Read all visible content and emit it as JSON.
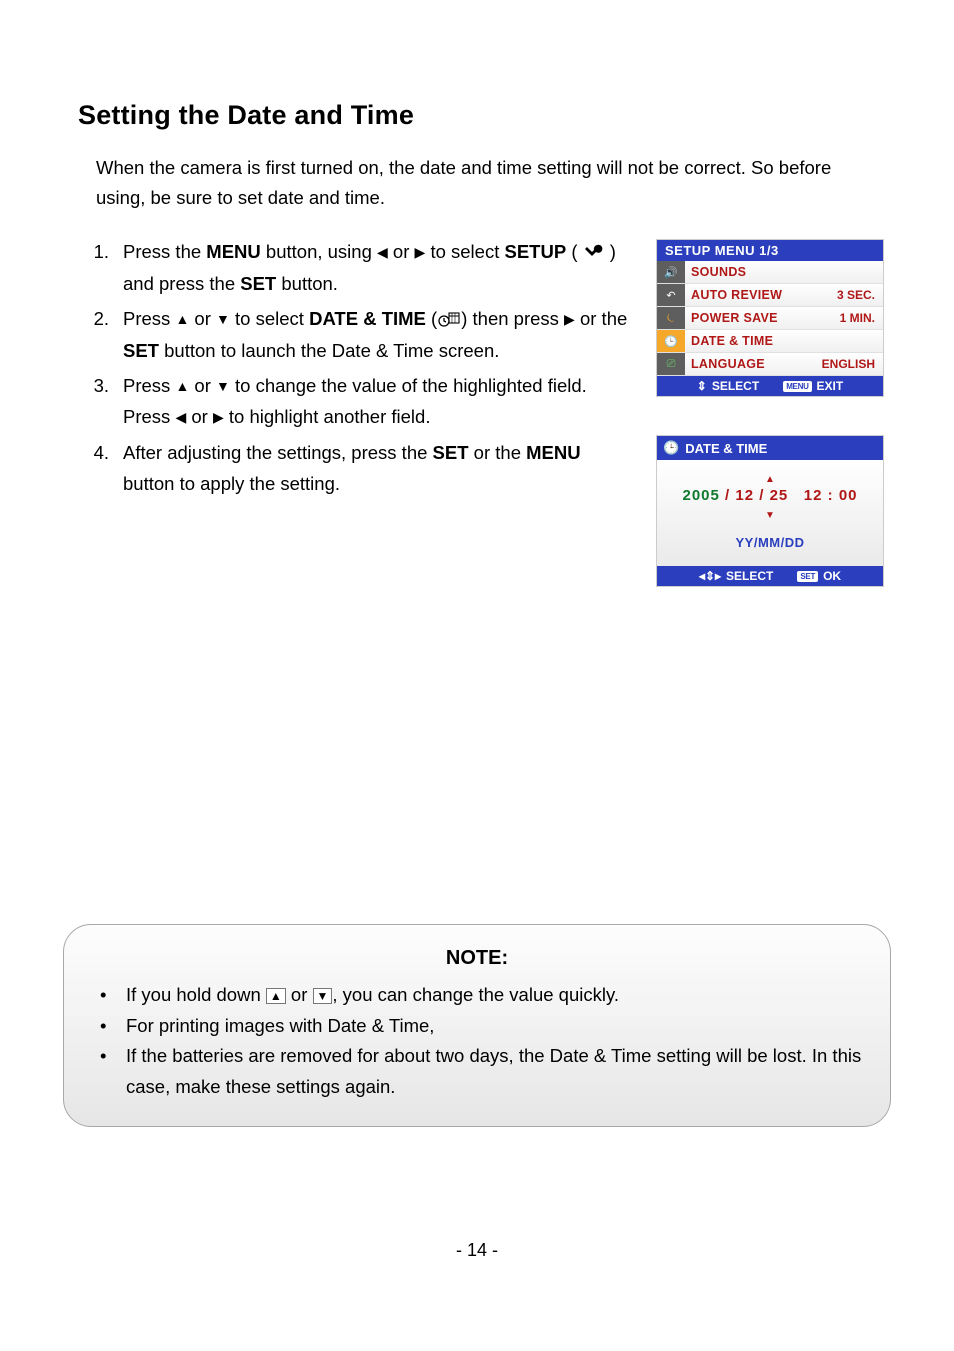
{
  "title": "Setting the Date and Time",
  "intro": "When the camera is first turned on, the date and time setting will not be correct. So before using, be sure to set date and time.",
  "steps": [
    {
      "num": "1.",
      "parts": {
        "a": "Press the ",
        "b": "MENU",
        "c": " button, using ",
        "d": " or ",
        "e": " to select ",
        "f": "SETUP",
        "g": " ( ",
        "h": " ) and press the ",
        "i": "SET",
        "j": " button."
      }
    },
    {
      "num": "2.",
      "parts": {
        "a": "Press ",
        "b": " or ",
        "c": " to select ",
        "d": "DATE & TIME",
        "e": " (",
        "f": ") then press ",
        "g": " or the ",
        "h": "SET",
        "i": " button to launch the Date & Time screen."
      }
    },
    {
      "num": "3.",
      "parts": {
        "a": "Press ",
        "b": " or ",
        "c": " to change the value of the highlighted field.   Press ",
        "d": " or ",
        "e": " to highlight another field."
      }
    },
    {
      "num": "4.",
      "parts": {
        "a": "After adjusting the settings, press the ",
        "b": "SET",
        "c": " or the ",
        "d": "MENU",
        "e": " button to apply the setting."
      }
    }
  ],
  "setup_menu": {
    "header": "SETUP MENU 1/3",
    "rows": [
      {
        "icon": "speaker",
        "label": "SOUNDS",
        "val": ""
      },
      {
        "icon": "undo",
        "label": "AUTO REVIEW",
        "val": "3 SEC."
      },
      {
        "icon": "power",
        "label": "POWER SAVE",
        "val": "1 MIN."
      },
      {
        "icon": "clock",
        "label": "DATE & TIME",
        "val": "",
        "selected": true
      },
      {
        "icon": "lang",
        "label": "LANGUAGE",
        "val": "ENGLISH"
      }
    ],
    "footer": {
      "select": "SELECT",
      "exit_badge": "MENU",
      "exit": "EXIT"
    }
  },
  "datetime_screen": {
    "header": "DATE & TIME",
    "year": "2005",
    "month": "12",
    "day": "25",
    "hour": "12",
    "minute": "00",
    "format": "YY/MM/DD",
    "footer": {
      "select": "SELECT",
      "ok_badge": "SET",
      "ok": "OK"
    }
  },
  "note": {
    "title": "NOTE:",
    "items": [
      {
        "a": "If you hold down ",
        "b": " or ",
        "c": ", you can change the value quickly."
      },
      {
        "a": "For printing images with Date & Time,"
      },
      {
        "a": "If the batteries are removed for about two days, the Date & Time setting will be lost. In this case, make these settings again."
      }
    ]
  },
  "page_number": "- 14 -"
}
